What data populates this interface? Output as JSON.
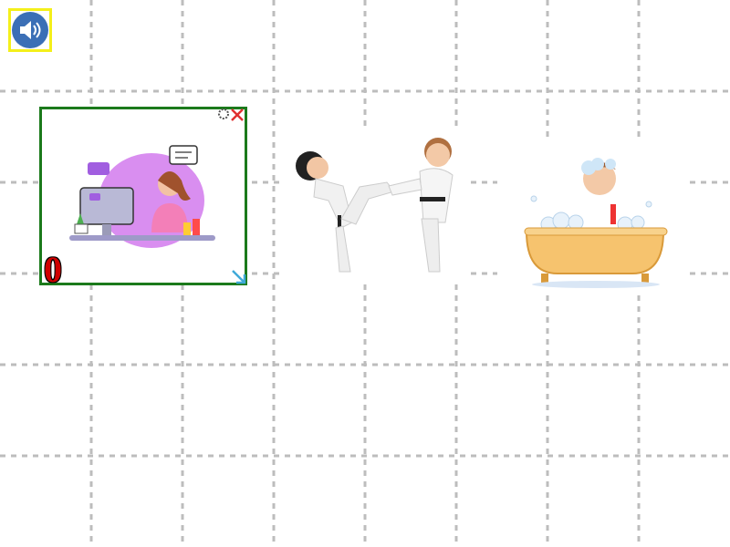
{
  "toolbar": {
    "sound_icon": "speaker-icon",
    "sound_border_color": "#f4ef1a",
    "sound_fill_color": "#3b6fb6"
  },
  "cards": [
    {
      "id": "computer-girl",
      "picture": "girl-at-computer",
      "selected": true,
      "counter": "0",
      "border_color": "#1b7a1b",
      "icons": [
        "close-icon",
        "rotate-icon",
        "resize-icon"
      ]
    },
    {
      "id": "karate",
      "picture": "karate-kids",
      "selected": false
    },
    {
      "id": "bath",
      "picture": "boy-in-bathtub",
      "selected": false
    }
  ],
  "colors": {
    "grid_line": "#bdbdbd",
    "counter": "#d00000",
    "close": "#e03030"
  }
}
